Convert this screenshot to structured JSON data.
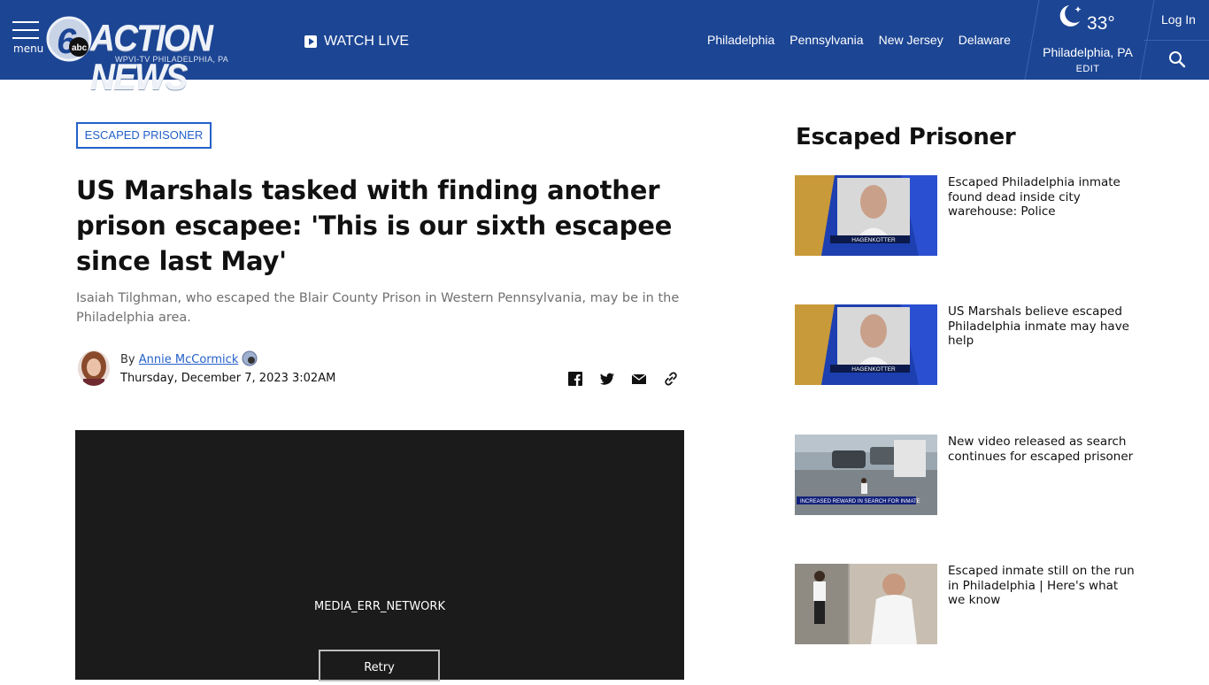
{
  "header": {
    "menu_label": "menu",
    "logo": {
      "title": "ACTION NEWS",
      "subtitle": "WPVI-TV  PHILADELPHIA, PA",
      "network": "abc",
      "number": "6"
    },
    "watch_live": "WATCH LIVE",
    "regions": [
      "Philadelphia",
      "Pennsylvania",
      "New Jersey",
      "Delaware"
    ],
    "weather": {
      "temp": "33°",
      "city": "Philadelphia, PA",
      "edit": "EDIT"
    },
    "login": "Log In",
    "icons": [
      "menu-icon",
      "play-icon",
      "moon-icon",
      "search-icon"
    ],
    "colors": {
      "header_bg": "#1c4594",
      "link_blue": "#2461c9"
    }
  },
  "article": {
    "tag": "ESCAPED PRISONER",
    "headline": "US Marshals tasked with finding another prison escapee: 'This is our sixth escapee since last May'",
    "summary": "Isaiah Tilghman, who escaped the Blair County Prison in Western Pennsylvania, may be in the Philadelphia area.",
    "byline_prefix": "By",
    "author": "Annie McCormick",
    "timestamp": "Thursday, December 7, 2023 3:02AM",
    "share_icons": [
      "facebook-icon",
      "twitter-icon",
      "email-icon",
      "link-icon"
    ],
    "player": {
      "error": "MEDIA_ERR_NETWORK",
      "retry": "Retry"
    }
  },
  "sidebar": {
    "title": "Escaped Prisoner",
    "items": [
      {
        "text": "Escaped Philadelphia inmate found dead inside city warehouse: Police",
        "thumb_caption": "HAGENKOTTER"
      },
      {
        "text": "US Marshals believe escaped Philadelphia inmate may have help",
        "thumb_caption": "HAGENKOTTER"
      },
      {
        "text": "New video released as search continues for escaped prisoner",
        "thumb_caption": "INCREASED REWARD IN SEARCH FOR INMATE"
      },
      {
        "text": "Escaped inmate still on the run in Philadelphia | Here's what we know",
        "thumb_caption": ""
      }
    ]
  }
}
